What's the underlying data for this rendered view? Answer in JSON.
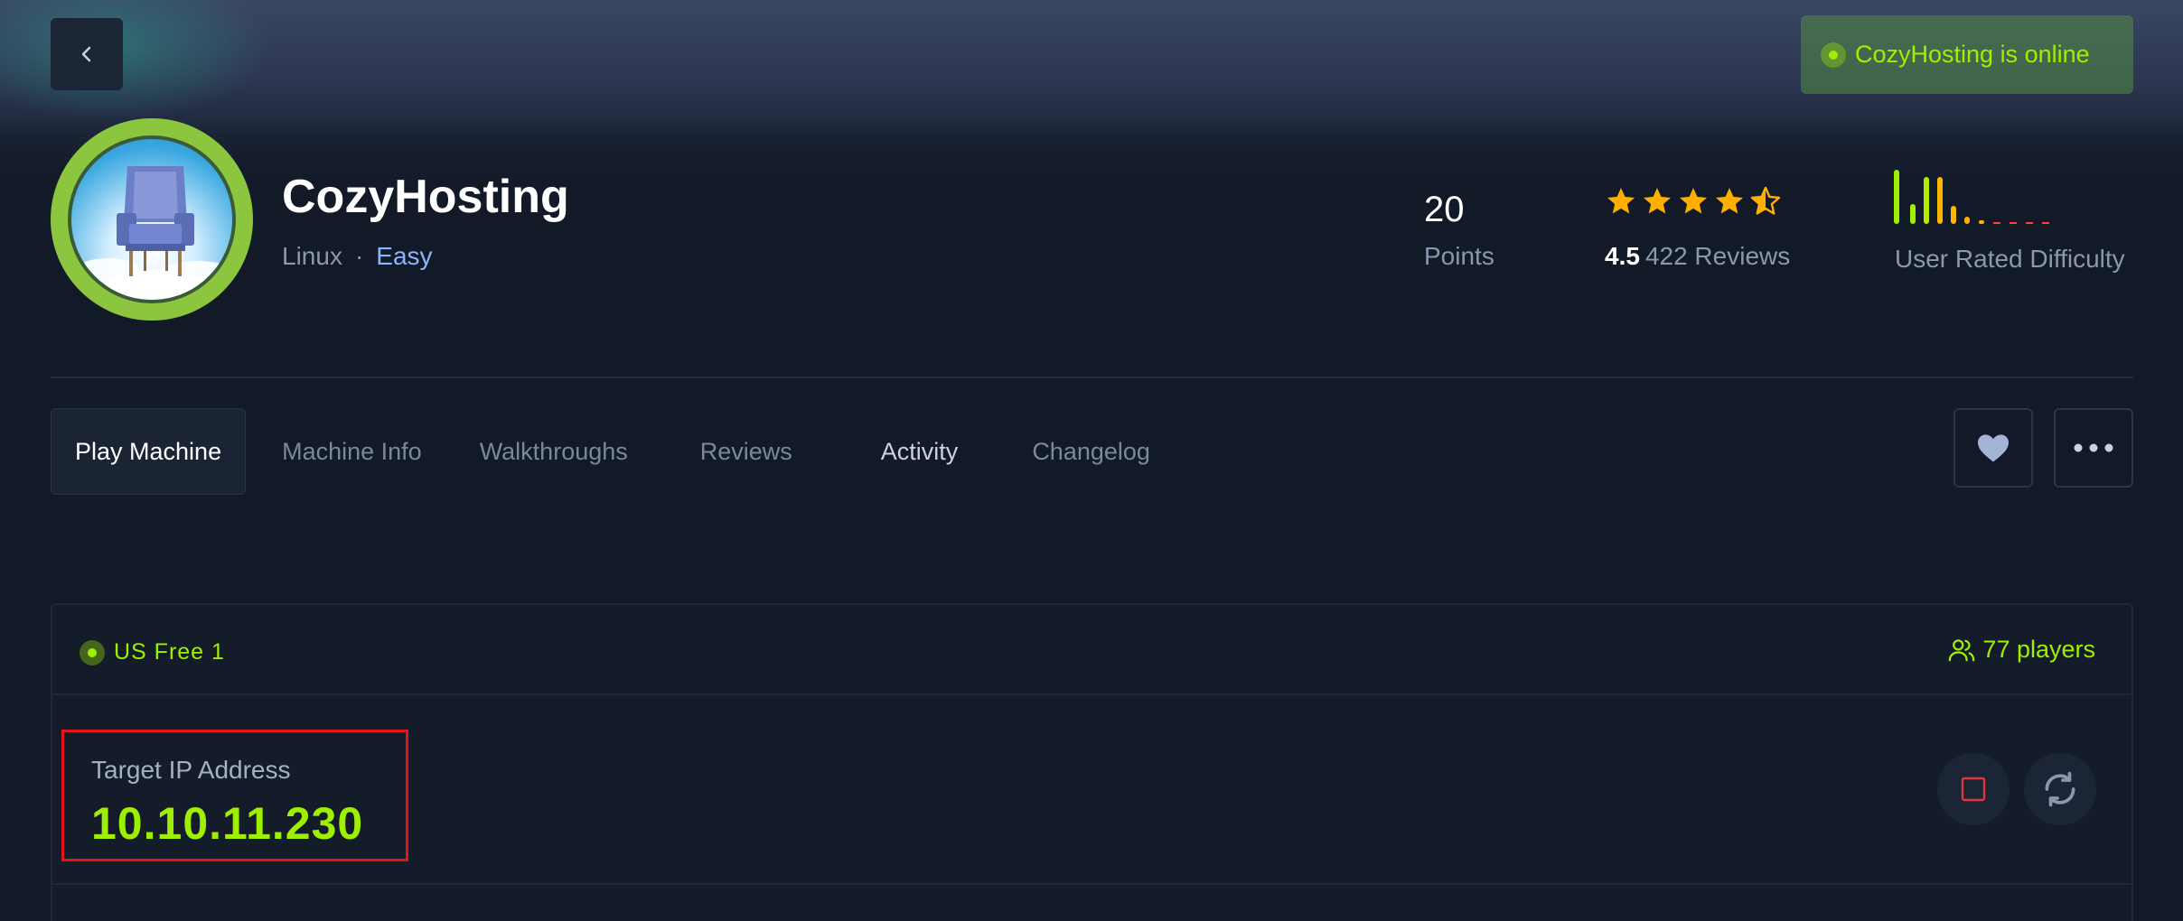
{
  "status": {
    "text": "CozyHosting is online",
    "color": "#9fef00"
  },
  "machine": {
    "name": "CozyHosting",
    "os": "Linux",
    "separator": "·",
    "difficulty": "Easy"
  },
  "stats": {
    "points_value": "20",
    "points_label": "Points",
    "rating": "4.5",
    "rating_stars": 4.5,
    "reviews": "422 Reviews",
    "difficulty_label": "User Rated Difficulty"
  },
  "tabs": [
    {
      "label": "Play Machine"
    },
    {
      "label": "Machine Info"
    },
    {
      "label": "Walkthroughs"
    },
    {
      "label": "Reviews"
    },
    {
      "label": "Activity"
    },
    {
      "label": "Changelog"
    }
  ],
  "actions": {
    "favorite_icon": "heart-icon",
    "more_icon": "more-horizontal-icon"
  },
  "panel": {
    "server": "US Free 1",
    "players": "77 players",
    "ip_label": "Target IP Address",
    "ip_value": "10.10.11.230",
    "stop_icon": "stop-icon",
    "reset_icon": "refresh-icon"
  },
  "colors": {
    "accent": "#9fef00",
    "star": "#ffaf00",
    "danger": "#e0161b"
  }
}
